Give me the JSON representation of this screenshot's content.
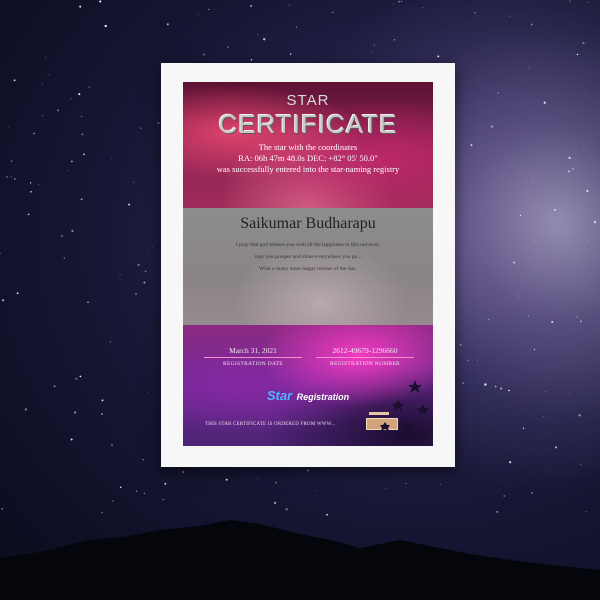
{
  "certificate": {
    "star_word": "STAR",
    "title": "CERTIFICATE",
    "intro": "The star with the coordinates",
    "coordinates": "RA: 06h 47m 48.0s   DEC: +82° 05' 50.0\"",
    "entered": "was successfully entered into the star-naming registry",
    "owner_name": "Saikumar Budharapu",
    "message": [
      "I pray that god blesses you with all the happiness in this universe,",
      "may you prosper and shine everywhere you go...",
      "Wish u many more happy returns of the day."
    ],
    "registration_date": "March 31, 2021",
    "registration_date_label": "REGISTRATION DATE",
    "registration_number": "2612-49679-1296660",
    "registration_number_label": "REGISTRATION NUMBER",
    "logo_star": "Star",
    "logo_registration": "Registration",
    "footer": "THIS STAR CERTIFICATE IS ORDERED FROM WWW..."
  },
  "colors": {
    "frame": "#f7f7f7",
    "name_band": "#8d8d8d",
    "logo_accent": "#4fb4ff"
  }
}
